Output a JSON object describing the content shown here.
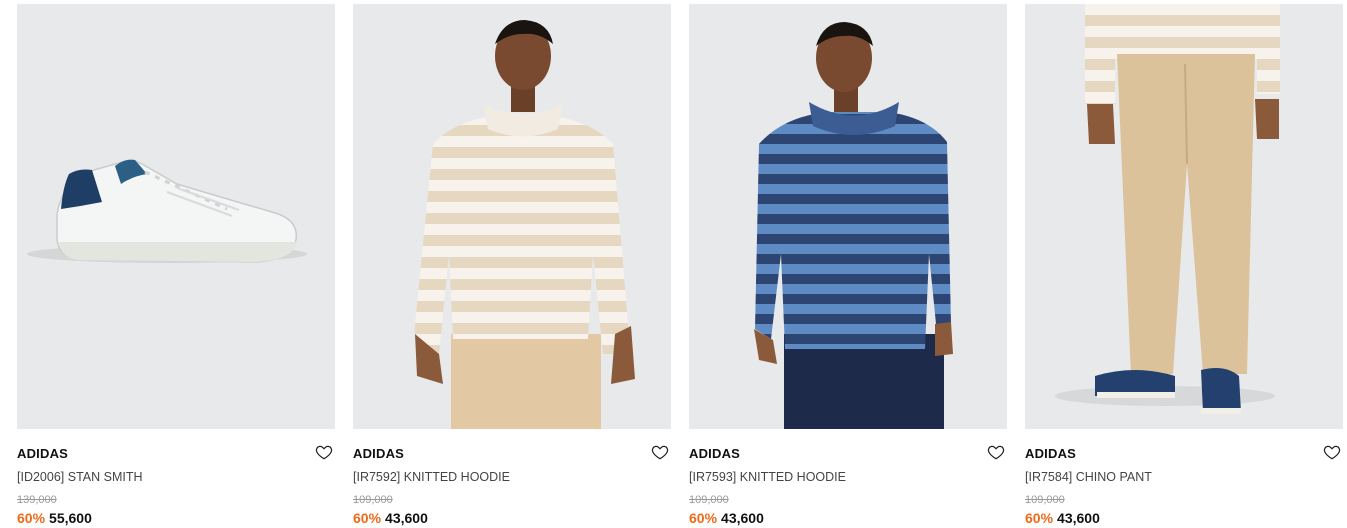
{
  "products": [
    {
      "brand": "ADIDAS",
      "name": "[ID2006] STAN SMITH",
      "original_price": "139,000",
      "discount": "60%",
      "price": "55,600",
      "image": "white sneaker with navy heel tab",
      "wishlist_icon": "heart-outline-icon"
    },
    {
      "brand": "ADIDAS",
      "name": "[IR7592] KNITTED HOODIE",
      "original_price": "109,000",
      "discount": "60%",
      "price": "43,600",
      "image": "model in cream/white striped hoodie and beige pants",
      "wishlist_icon": "heart-outline-icon"
    },
    {
      "brand": "ADIDAS",
      "name": "[IR7593] KNITTED HOODIE",
      "original_price": "109,000",
      "discount": "60%",
      "price": "43,600",
      "image": "model in blue/navy striped hoodie and navy pants",
      "wishlist_icon": "heart-outline-icon"
    },
    {
      "brand": "ADIDAS",
      "name": "[IR7584] CHINO PANT",
      "original_price": "109,000",
      "discount": "60%",
      "price": "43,600",
      "image": "beige chino pants with navy sneakers",
      "wishlist_icon": "heart-outline-icon"
    }
  ],
  "colors": {
    "discount": "#ec6b1a",
    "image_bg": "#e8e9eb",
    "text": "#111111",
    "muted": "#9a9a9a"
  }
}
